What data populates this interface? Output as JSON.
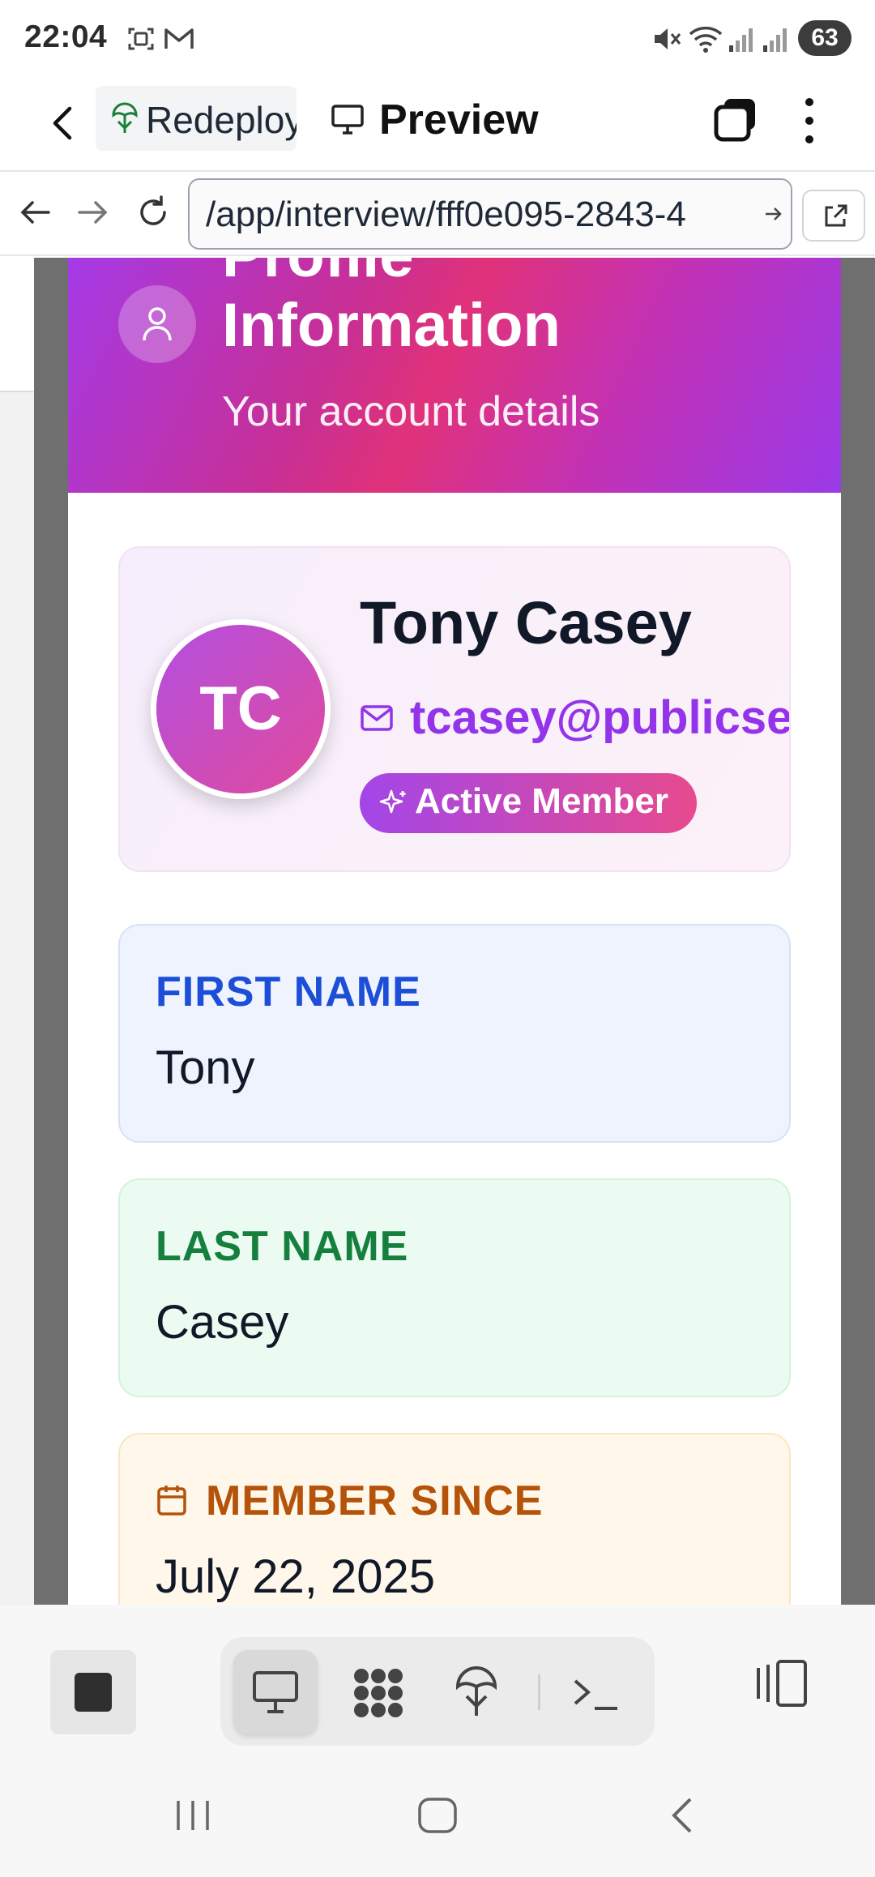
{
  "status_bar": {
    "time": "22:04",
    "battery": "63"
  },
  "app_bar": {
    "project_tab_label": "Redeploy",
    "preview_tab_label": "Preview"
  },
  "url_bar": {
    "url": "/app/interview/fff0e095-2843-4"
  },
  "modal": {
    "header_title_partial": "Profile",
    "header_title": "Information",
    "header_subtitle": "Your account details"
  },
  "profile": {
    "initials": "TC",
    "name": "Tony Casey",
    "email": "tcasey@publicservice",
    "badge": "Active Member"
  },
  "fields": {
    "first_name_label": "FIRST NAME",
    "first_name_value": "Tony",
    "last_name_label": "LAST NAME",
    "last_name_value": "Casey",
    "member_since_label": "MEMBER SINCE",
    "member_since_value": "July 22, 2025"
  },
  "toolbar": {
    "tools": [
      "desktop-icon",
      "grid-icon",
      "deploy-icon",
      "terminal-icon"
    ],
    "active_tool": "desktop-icon"
  },
  "colors": {
    "accent_purple": "#9333ea",
    "accent_pink": "#e0327a",
    "first_name_label": "#1d4ed8",
    "last_name_label": "#15803d",
    "member_since_label": "#b45309"
  }
}
